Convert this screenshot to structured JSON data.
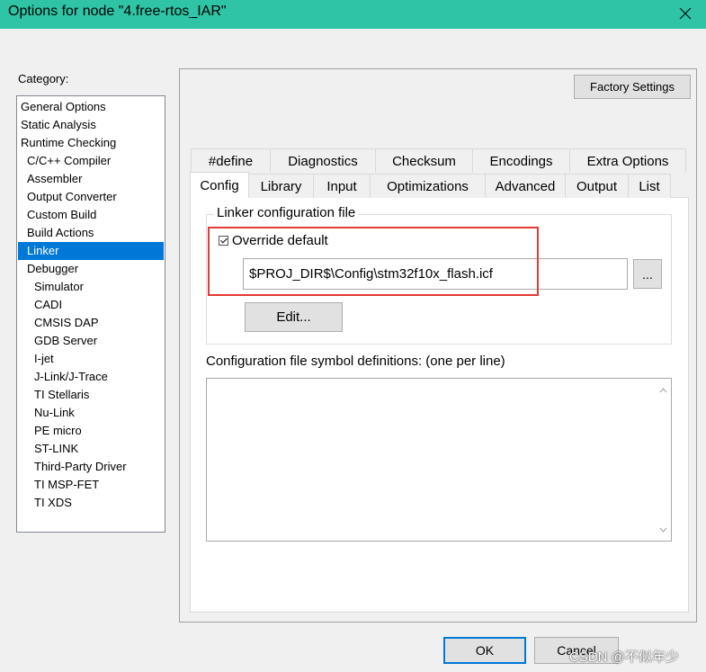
{
  "window": {
    "title": "Options for node \"4.free-rtos_IAR\""
  },
  "category": {
    "label": "Category:",
    "items": [
      {
        "label": "General Options",
        "indent": 0
      },
      {
        "label": "Static Analysis",
        "indent": 0
      },
      {
        "label": "Runtime Checking",
        "indent": 0
      },
      {
        "label": "C/C++ Compiler",
        "indent": 1
      },
      {
        "label": "Assembler",
        "indent": 1
      },
      {
        "label": "Output Converter",
        "indent": 1
      },
      {
        "label": "Custom Build",
        "indent": 1
      },
      {
        "label": "Build Actions",
        "indent": 1
      },
      {
        "label": "Linker",
        "indent": 1,
        "selected": true
      },
      {
        "label": "Debugger",
        "indent": 1
      },
      {
        "label": "Simulator",
        "indent": 2
      },
      {
        "label": "CADI",
        "indent": 2
      },
      {
        "label": "CMSIS DAP",
        "indent": 2
      },
      {
        "label": "GDB Server",
        "indent": 2
      },
      {
        "label": "I-jet",
        "indent": 2
      },
      {
        "label": "J-Link/J-Trace",
        "indent": 2
      },
      {
        "label": "TI Stellaris",
        "indent": 2
      },
      {
        "label": "Nu-Link",
        "indent": 2
      },
      {
        "label": "PE micro",
        "indent": 2
      },
      {
        "label": "ST-LINK",
        "indent": 2
      },
      {
        "label": "Third-Party Driver",
        "indent": 2
      },
      {
        "label": "TI MSP-FET",
        "indent": 2
      },
      {
        "label": "TI XDS",
        "indent": 2
      }
    ]
  },
  "factory_settings_label": "Factory Settings",
  "tabs": {
    "row1": [
      "#define",
      "Diagnostics",
      "Checksum",
      "Encodings",
      "Extra Options"
    ],
    "row2": [
      "Config",
      "Library",
      "Input",
      "Optimizations",
      "Advanced",
      "Output",
      "List"
    ],
    "active": "Config"
  },
  "config": {
    "group_title": "Linker configuration file",
    "override_label": "Override default",
    "override_checked": true,
    "path_value": "$PROJ_DIR$\\Config\\stm32f10x_flash.icf",
    "browse_label": "...",
    "edit_label": "Edit...",
    "defs_label": "Configuration file symbol definitions: (one per line)",
    "defs_value": ""
  },
  "buttons": {
    "ok": "OK",
    "cancel": "Cancel"
  },
  "watermark": "CSDN @不似年少",
  "colors": {
    "titlebar": "#2ec4a5",
    "selection": "#0078d7",
    "highlight_box": "#e53935"
  },
  "icons": {
    "close": "close-icon",
    "scroll_up": "scroll-up-arrow-icon",
    "scroll_down": "scroll-down-arrow-icon",
    "checkbox": "checkbox-checked-icon"
  }
}
